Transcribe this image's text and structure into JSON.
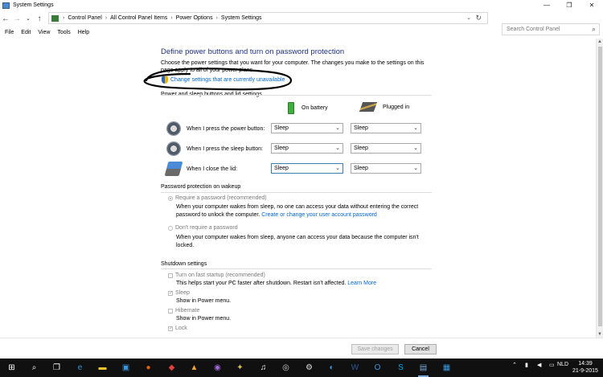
{
  "window": {
    "title": "System Settings",
    "controls": [
      "—",
      "❐",
      "✕"
    ]
  },
  "address": {
    "crumbs": [
      "Control Panel",
      "All Control Panel Items",
      "Power Options",
      "System Settings"
    ],
    "search_placeholder": "Search Control Panel"
  },
  "menu": [
    "File",
    "Edit",
    "View",
    "Tools",
    "Help"
  ],
  "page": {
    "heading": "Define power buttons and turn on password protection",
    "description": "Choose the power settings that you want for your computer. The changes you make to the settings on this page apply to all of your power plans.",
    "change_link": "Change settings that are currently unavailable"
  },
  "power_section": {
    "title": "Power and sleep buttons and lid settings",
    "col_battery": "On battery",
    "col_plugged": "Plugged in",
    "rows": [
      {
        "label": "When I press the power button:",
        "battery": "Sleep",
        "plugged": "Sleep"
      },
      {
        "label": "When I press the sleep button:",
        "battery": "Sleep",
        "plugged": "Sleep"
      },
      {
        "label": "When I close the lid:",
        "battery": "Sleep",
        "plugged": "Sleep"
      }
    ]
  },
  "password_section": {
    "title": "Password protection on wakeup",
    "require_label": "Require a password (recommended)",
    "require_desc": "When your computer wakes from sleep, no one can access your data without entering the correct password to unlock the computer.",
    "require_link": "Create or change your user account password",
    "no_require_label": "Don't require a password",
    "no_require_desc": "When your computer wakes from sleep, anyone can access your data because the computer isn't locked."
  },
  "shutdown_section": {
    "title": "Shutdown settings",
    "fast_startup_label": "Turn on fast startup (recommended)",
    "fast_startup_desc": "This helps start your PC faster after shutdown. Restart isn't affected.",
    "learn_more": "Learn More",
    "sleep_label": "Sleep",
    "sleep_desc": "Show in Power menu.",
    "hibernate_label": "Hibernate",
    "hibernate_desc": "Show in Power menu.",
    "lock_label": "Lock"
  },
  "footer": {
    "save_label": "Save changes",
    "cancel_label": "Cancel"
  },
  "taskbar": {
    "lang": "NLD",
    "time": "14:39",
    "date": "21-9-2015"
  }
}
